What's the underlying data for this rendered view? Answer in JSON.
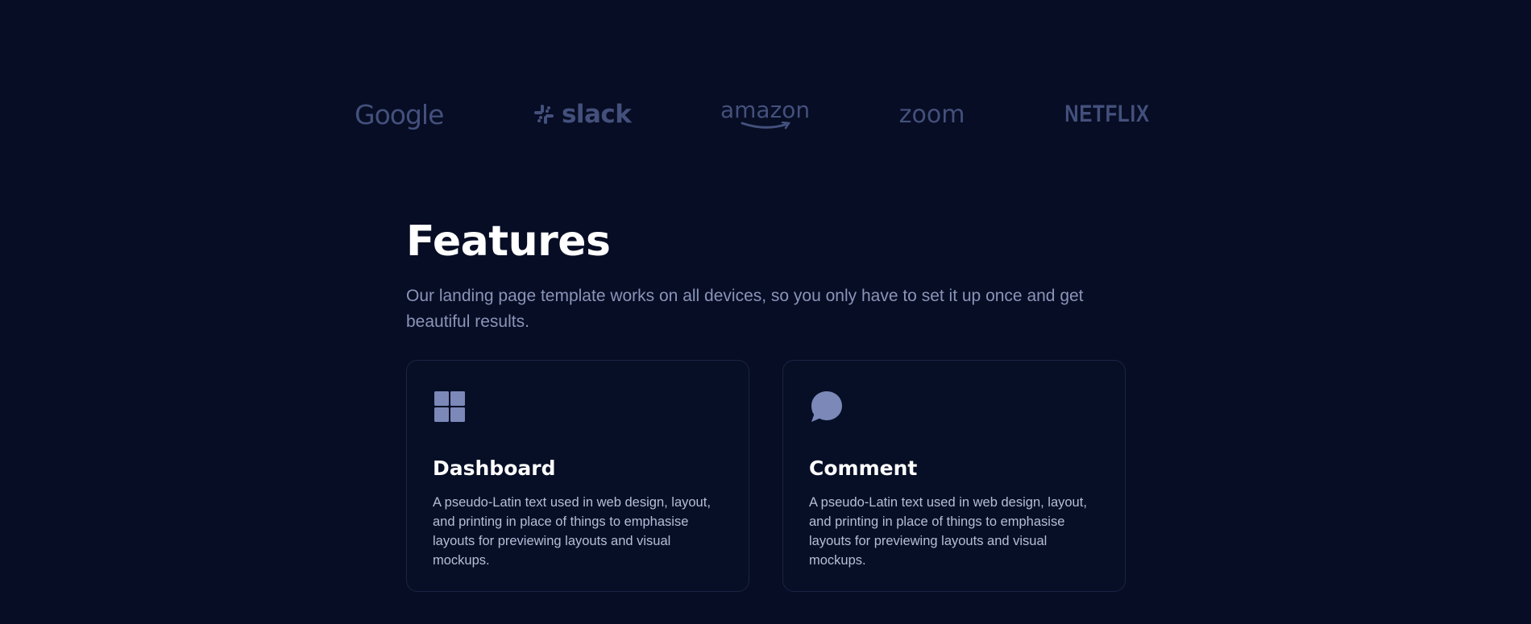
{
  "logos": {
    "google": "Google",
    "slack": "slack",
    "amazon": "amazon",
    "zoom": "zoom",
    "netflix": "NETFLIX"
  },
  "features": {
    "title": "Features",
    "description": "Our landing page template works on all devices, so you only have to set it up once and get beautiful results."
  },
  "cards": [
    {
      "icon": "grid-icon",
      "title": "Dashboard",
      "text": "A pseudo-Latin text used in web design, layout, and printing in place of things to emphasise layouts for previewing layouts and visual mockups."
    },
    {
      "icon": "chat-bubble-icon",
      "title": "Comment",
      "text": "A pseudo-Latin text used in web design, layout, and printing in place of things to emphasise layouts for previewing layouts and visual mockups."
    }
  ],
  "colors": {
    "background": "#060d24",
    "logo": "#44507c",
    "icon": "#7b88b8",
    "heading": "#ffffff",
    "muted_text": "#8a94b8",
    "card_border": "#1b2442"
  }
}
